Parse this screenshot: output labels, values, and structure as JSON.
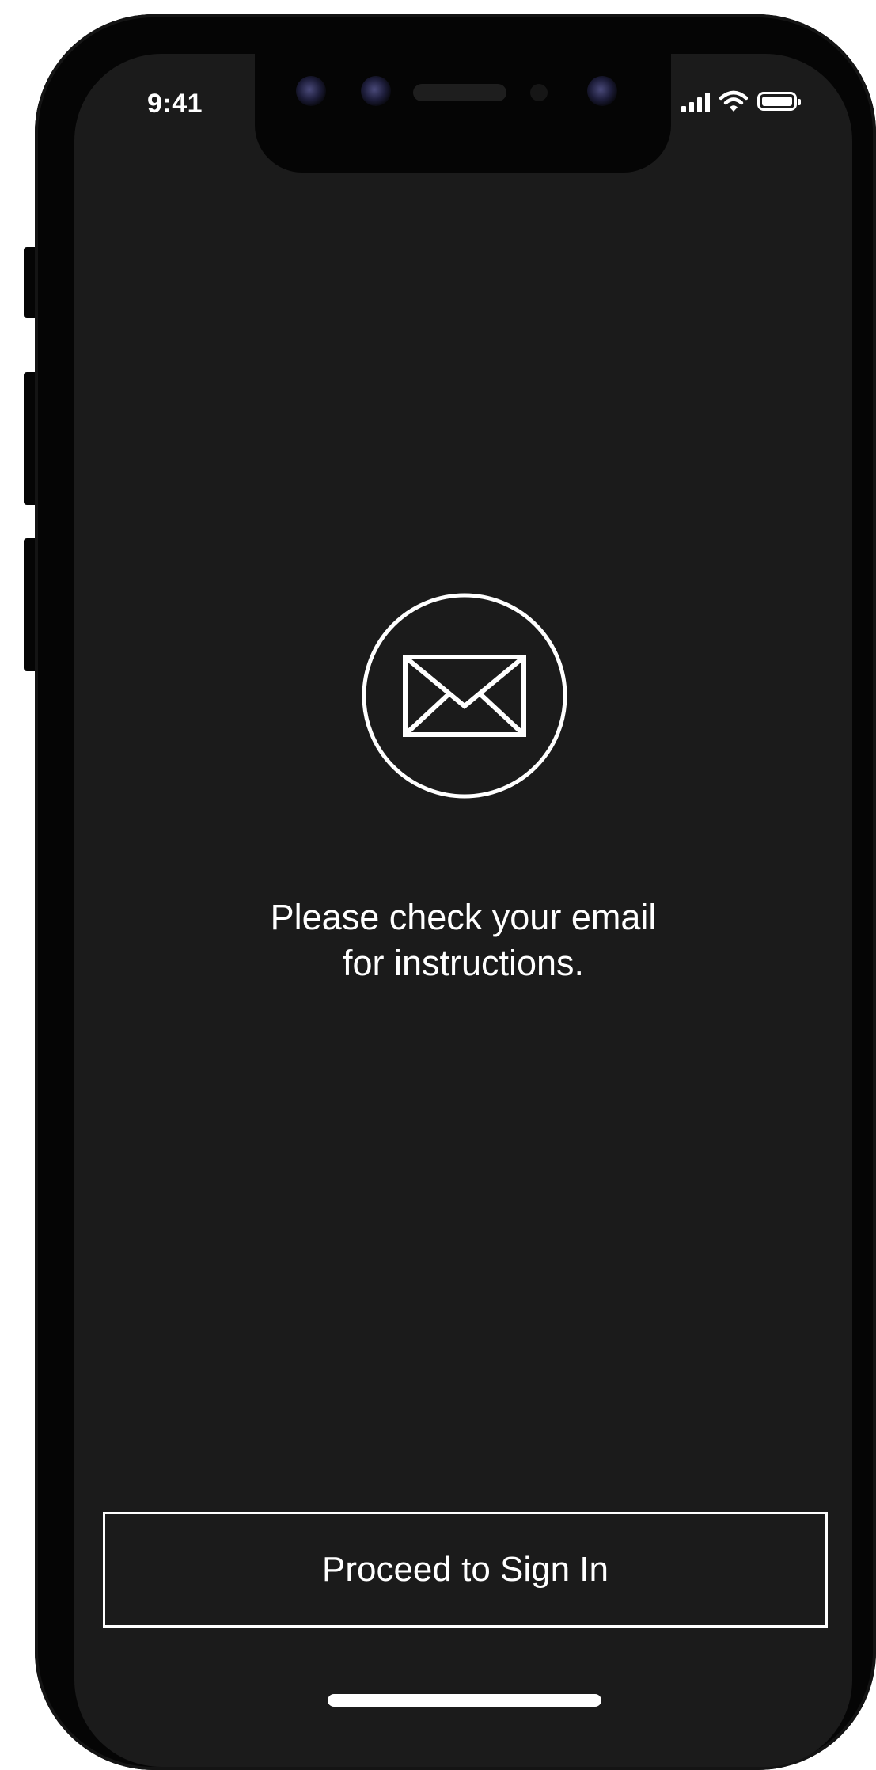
{
  "status_bar": {
    "time": "9:41",
    "signal_icon": "cellular-signal-icon",
    "wifi_icon": "wifi-icon",
    "battery_icon": "battery-icon",
    "battery_level": 1.0
  },
  "main": {
    "icon": "envelope-icon",
    "message_line_1": "Please check your email",
    "message_line_2": "for instructions."
  },
  "actions": {
    "proceed_label": "Proceed to Sign In"
  },
  "colors": {
    "screen_background": "#1b1b1b",
    "device_frame": "#050505",
    "foreground": "#ffffff"
  }
}
